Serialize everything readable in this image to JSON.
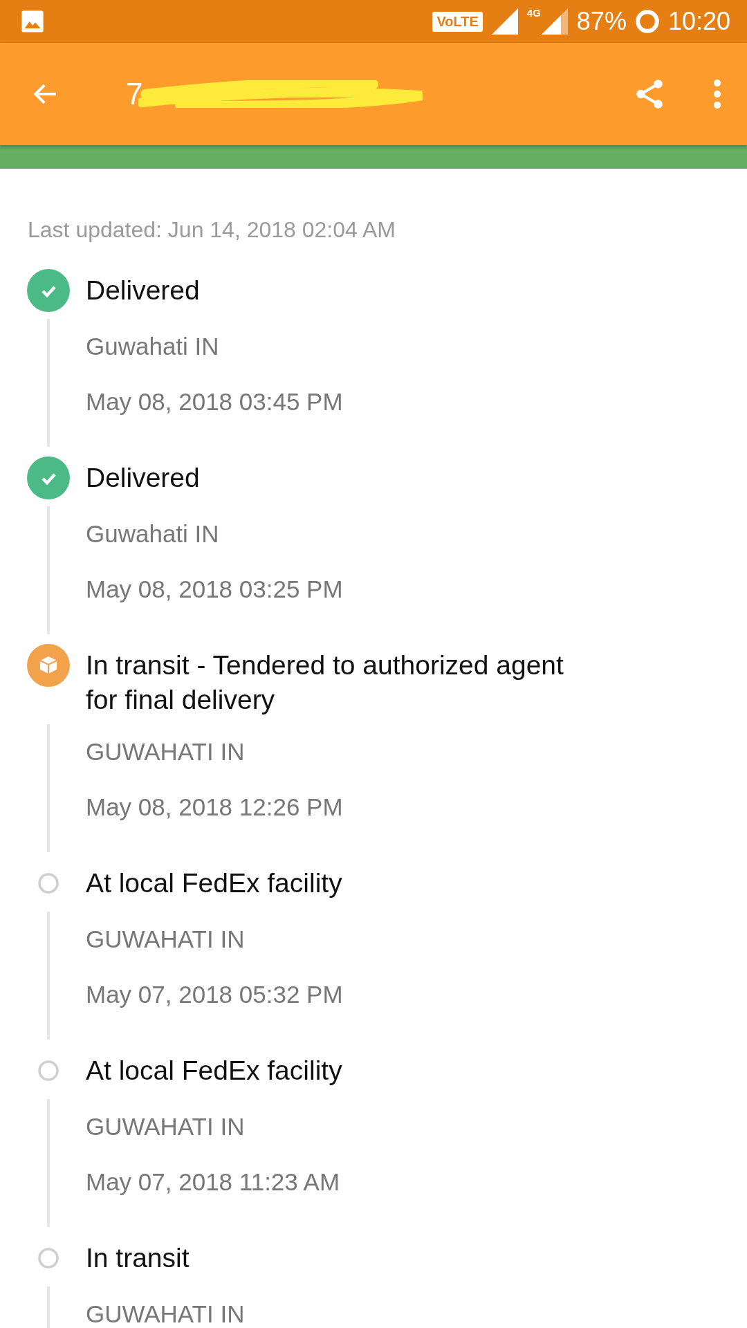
{
  "status_bar": {
    "network_badge": "VoLTE",
    "network_type": "4G",
    "battery": "87%",
    "time": "10:20"
  },
  "toolbar": {
    "title": "7"
  },
  "last_updated": "Last updated: Jun 14, 2018 02:04 AM",
  "events": [
    {
      "kind": "delivered",
      "title": "Delivered",
      "location": "Guwahati IN",
      "time": "May 08, 2018 03:45 PM"
    },
    {
      "kind": "delivered",
      "title": "Delivered",
      "location": "Guwahati IN",
      "time": "May 08, 2018 03:25 PM"
    },
    {
      "kind": "transit",
      "title": "In transit - Tendered to authorized agent for final delivery",
      "location": "GUWAHATI IN",
      "time": "May 08, 2018 12:26 PM"
    },
    {
      "kind": "pending",
      "title": "At local FedEx facility",
      "location": "GUWAHATI IN",
      "time": "May 07, 2018 05:32 PM"
    },
    {
      "kind": "pending",
      "title": "At local FedEx facility",
      "location": "GUWAHATI IN",
      "time": "May 07, 2018 11:23 AM"
    },
    {
      "kind": "pending",
      "title": "In transit",
      "location": "GUWAHATI IN"
    }
  ]
}
